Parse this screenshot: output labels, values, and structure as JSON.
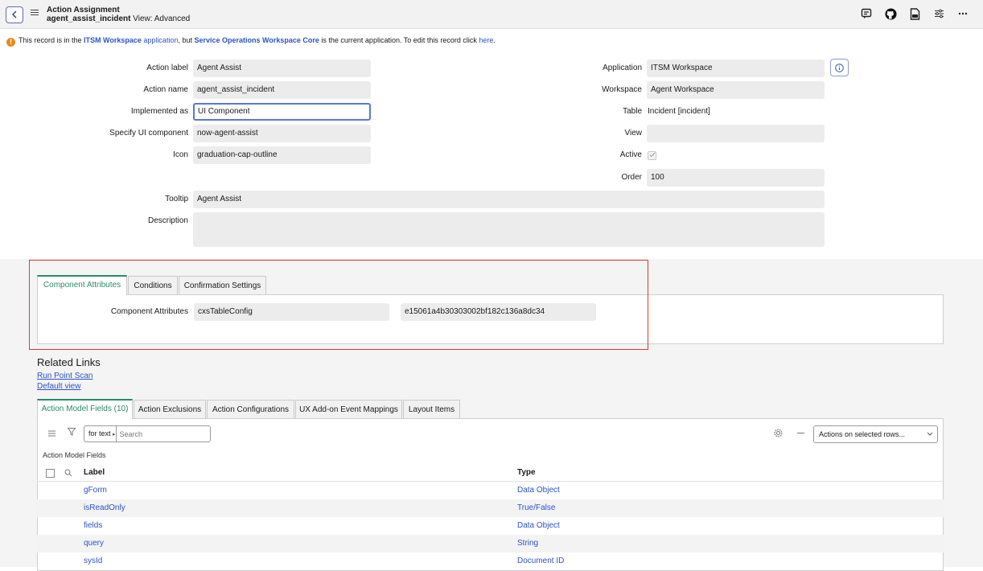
{
  "header": {
    "title": "Action Assignment",
    "record_name": "agent_assist_incident",
    "view_label": "View: Advanced"
  },
  "icons": {
    "back": "chevron-left-icon",
    "menu": "hamburger-icon",
    "comments": "comment-icon",
    "github": "github-icon",
    "document": "document-icon",
    "settings": "sliders-icon",
    "more": "more-icon"
  },
  "banner": {
    "prefix": "This record is in the",
    "app_name": "ITSM Workspace",
    "app_word": "application",
    "middle": ", but",
    "current_app": "Service Operations Workspace Core",
    "suffix": "is the current application. To edit this record click",
    "link": "here",
    "end": "."
  },
  "form": {
    "action_label": {
      "label": "Action label",
      "value": "Agent Assist"
    },
    "action_name": {
      "label": "Action name",
      "value": "agent_assist_incident"
    },
    "implemented_as": {
      "label": "Implemented as",
      "value": "UI Component"
    },
    "ui_component": {
      "label": "Specify UI component",
      "value": "now-agent-assist"
    },
    "icon": {
      "label": "Icon",
      "value": "graduation-cap-outline"
    },
    "application": {
      "label": "Application",
      "value": "ITSM Workspace"
    },
    "workspace": {
      "label": "Workspace",
      "value": "Agent Workspace"
    },
    "table": {
      "label": "Table",
      "value": "Incident [incident]"
    },
    "view": {
      "label": "View",
      "value": ""
    },
    "active": {
      "label": "Active",
      "checked": true
    },
    "order": {
      "label": "Order",
      "value": "100"
    },
    "tooltip": {
      "label": "Tooltip",
      "value": "Agent Assist"
    },
    "description": {
      "label": "Description",
      "value": ""
    }
  },
  "section_tabs": [
    "Component Attributes",
    "Conditions",
    "Confirmation Settings"
  ],
  "component_attributes": {
    "label": "Component Attributes",
    "name": "cxsTableConfig",
    "value": "e15061a4b30303002bf182c136a8dc34"
  },
  "related_links": {
    "title": "Related Links",
    "links": [
      "Run Point Scan",
      "Default view"
    ]
  },
  "list_tabs": [
    "Action Model Fields (10)",
    "Action Exclusions",
    "Action Configurations",
    "UX Add-on Event Mappings",
    "Layout Items"
  ],
  "list": {
    "search_field": "for text",
    "search_placeholder": "Search",
    "actions_label": "Actions on selected rows...",
    "caption": "Action Model Fields",
    "columns": [
      "Label",
      "Type"
    ],
    "rows": [
      {
        "label": "gForm",
        "type": "Data Object"
      },
      {
        "label": "isReadOnly",
        "type": "True/False"
      },
      {
        "label": "fields",
        "type": "Data Object"
      },
      {
        "label": "query",
        "type": "String"
      },
      {
        "label": "sysId",
        "type": "Document ID"
      }
    ]
  }
}
